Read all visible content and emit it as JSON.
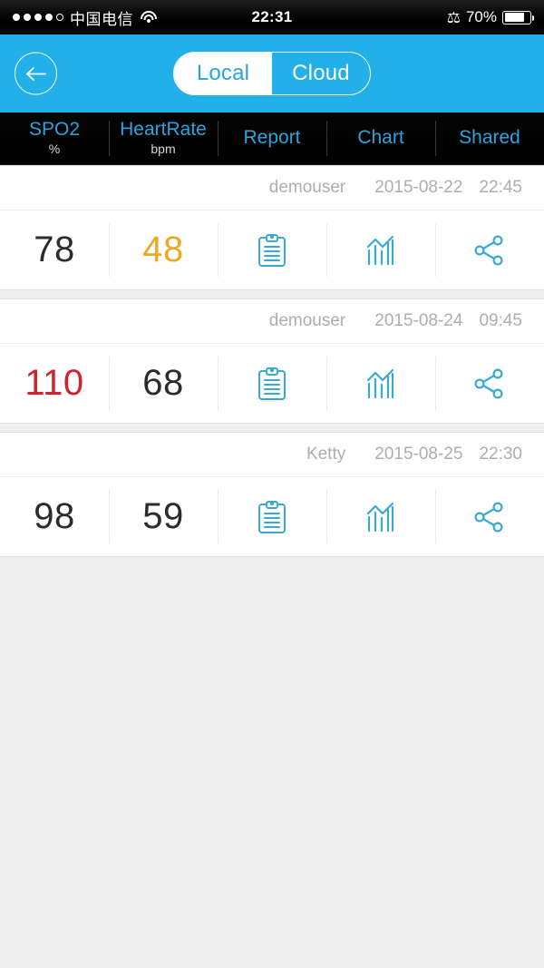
{
  "status_bar": {
    "signal_dots_filled": 4,
    "signal_dots_total": 5,
    "carrier": "中国电信",
    "wifi_icon": "wifi-icon",
    "time": "22:31",
    "bluetooth_icon": "bluetooth-icon",
    "battery_percent": "70%",
    "battery_level": 70
  },
  "header": {
    "back_icon": "back-arrow-icon",
    "segments": [
      {
        "label": "Local",
        "active": true
      },
      {
        "label": "Cloud",
        "active": false
      }
    ]
  },
  "columns": [
    {
      "title": "SPO2",
      "unit": "%"
    },
    {
      "title": "HeartRate",
      "unit": "bpm"
    },
    {
      "title": "Report",
      "unit": ""
    },
    {
      "title": "Chart",
      "unit": ""
    },
    {
      "title": "Shared",
      "unit": ""
    }
  ],
  "icons": {
    "report": "clipboard-report-icon",
    "chart": "bar-chart-icon",
    "share": "share-nodes-icon"
  },
  "colors": {
    "header_blue": "#22b0e8",
    "accent_blue": "#2ba4dd",
    "normal_value": "#2b2b2b",
    "warning_value": "#efa824",
    "alert_value": "#d1222f",
    "meta_gray": "#adadad",
    "page_background": "#efefef"
  },
  "records": [
    {
      "user": "demouser",
      "date": "2015-08-22",
      "time": "22:45",
      "spo2": "78",
      "spo2_state": "normal",
      "heart_rate": "48",
      "heart_rate_state": "warning"
    },
    {
      "user": "demouser",
      "date": "2015-08-24",
      "time": "09:45",
      "spo2": "110",
      "spo2_state": "alert",
      "heart_rate": "68",
      "heart_rate_state": "normal"
    },
    {
      "user": "Ketty",
      "date": "2015-08-25",
      "time": "22:30",
      "spo2": "98",
      "spo2_state": "normal",
      "heart_rate": "59",
      "heart_rate_state": "normal"
    }
  ]
}
